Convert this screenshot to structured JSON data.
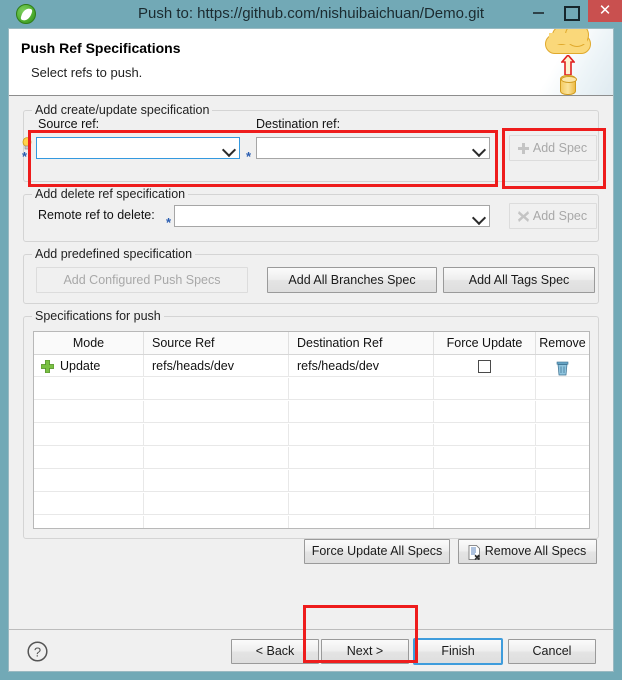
{
  "window": {
    "title": "Push to: https://github.com/nishuibaichuan/Demo.git",
    "app_icon": "spring-leaf-icon",
    "minimize_label": "–",
    "maximize_label": "□",
    "close_label": "✕"
  },
  "header": {
    "title": "Push Ref Specifications",
    "subtitle": "Select refs to push.",
    "graphic": "cloud-push-icon"
  },
  "groups": {
    "create_update": {
      "title": "Add create/update specification",
      "source_label": "Source ref:",
      "source_value": "",
      "destination_label": "Destination ref:",
      "destination_value": "",
      "add_spec_label": "Add Spec",
      "add_spec_icon": "plus-icon",
      "add_spec_enabled": false,
      "hint_icon": "lightbulb-icon",
      "required_marker": "*"
    },
    "delete_ref": {
      "title": "Add delete ref specification",
      "remote_label": "Remote ref to delete:",
      "remote_value": "",
      "add_spec_label": "Add Spec",
      "add_spec_icon": "x-icon",
      "add_spec_enabled": false,
      "required_marker": "*"
    },
    "predefined": {
      "title": "Add predefined specification",
      "configured_label": "Add Configured Push Specs",
      "configured_enabled": false,
      "all_branches_label": "Add All Branches Spec",
      "all_tags_label": "Add All Tags Spec"
    },
    "specs": {
      "title": "Specifications for push",
      "columns": [
        "Mode",
        "Source Ref",
        "Destination Ref",
        "Force Update",
        "Remove"
      ],
      "rows": [
        {
          "mode_icon": "green-plus-icon",
          "mode": "Update",
          "source_ref": "refs/heads/dev",
          "destination_ref": "refs/heads/dev",
          "force_update": false,
          "remove_icon": "trash-icon"
        }
      ],
      "empty_row_count": 7,
      "force_update_all_label": "Force Update All Specs",
      "remove_all_label": "Remove All Specs",
      "remove_all_icon": "document-remove-icon"
    }
  },
  "buttonbar": {
    "help_icon": "question-mark-icon",
    "back_label": "< Back",
    "next_label": "Next >",
    "finish_label": "Finish",
    "cancel_label": "Cancel",
    "focused_button": "Finish"
  },
  "annotations": {
    "color": "#ee1c1c",
    "boxes": [
      {
        "name": "source-destination-ref-highlight"
      },
      {
        "name": "add-spec-button-highlight"
      },
      {
        "name": "next-button-highlight"
      }
    ]
  },
  "colors": {
    "titlebar": "#72a9b6",
    "close_button": "#c9504f",
    "dialog_bg": "#f0f0f0",
    "header_bg": "#ffffff",
    "focus_blue": "#3e9cdc",
    "annotation_red": "#ee1c1c"
  }
}
